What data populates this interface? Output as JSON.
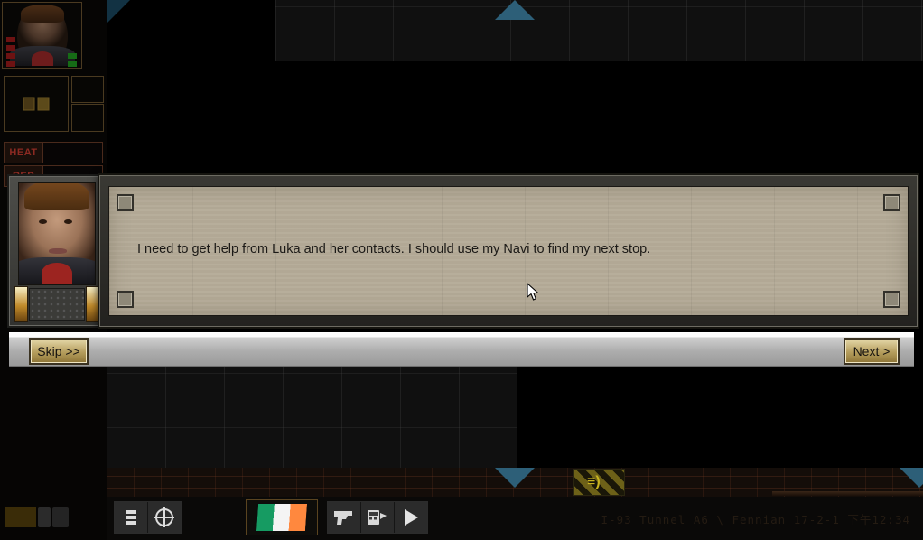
{
  "scene": {
    "location_status": "I-93 Tunnel A6 \\ Fennian 17-2-1 下午12:34",
    "markers": {
      "waypoint_up_name": "waypoint-marker-up",
      "waypoint_down_name": "waypoint-marker-down"
    },
    "hazard_sign_glyph": "≡)"
  },
  "hud": {
    "portrait_name": "player-portrait",
    "meters": [
      {
        "label": "HEAT",
        "value": 0
      },
      {
        "label": "REP",
        "value": 0
      }
    ],
    "inventory_slots": [
      {
        "name": "primary-item-slot",
        "occupied": true
      },
      {
        "name": "secondary-slot-top",
        "occupied": false
      },
      {
        "name": "secondary-slot-bottom",
        "occupied": false
      }
    ]
  },
  "dialog": {
    "speaker_portrait_name": "dialog-speaker-portrait",
    "text": "I need to get help from Luka and her contacts. I should use my Navi to find my next stop.",
    "skip_label": "Skip >>",
    "next_label": "Next >"
  },
  "toolbar": {
    "buttons": [
      {
        "name": "menu-button",
        "icon": "menu-icon"
      },
      {
        "name": "target-button",
        "icon": "crosshair-icon"
      },
      {
        "name": "faction-flag-button",
        "icon": "flag-icon"
      },
      {
        "name": "weapon-button",
        "icon": "pistol-icon"
      },
      {
        "name": "scanner-button",
        "icon": "scanner-icon"
      },
      {
        "name": "end-turn-button",
        "icon": "play-icon"
      }
    ]
  },
  "colors": {
    "panel_paper": "#b5ab98",
    "button_gold": "#b49d5c",
    "marker_teal": "#2d5f78",
    "heat_red": "#8c2a22",
    "hazard_yellow": "#c8b420"
  }
}
